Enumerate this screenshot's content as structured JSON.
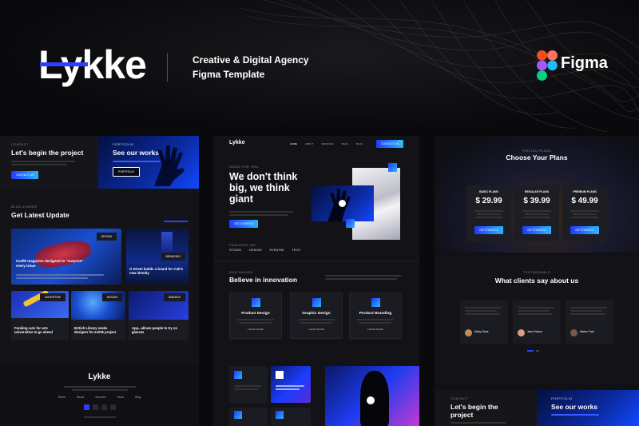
{
  "header": {
    "logo": "Lykke",
    "tagline_line1": "Creative & Digital Agency",
    "tagline_line2": "Figma Template",
    "tool": "Figma"
  },
  "colors": {
    "accent": "#1f3bff",
    "accent2": "#2ab4ff",
    "bg": "#0a0a0c",
    "panel": "#141418"
  },
  "left": {
    "contact_kicker": "CONTACT",
    "contact_title": "Let's begin the project",
    "contact_btn": "CONTACT US",
    "portfolio_kicker": "PORTFOLIO",
    "portfolio_title": "See our works",
    "portfolio_btn": "PORTFOLIO",
    "news_kicker": "BLOG & NEWS",
    "news_title": "Get Latest Update",
    "posts": [
      {
        "tag": "DESIGN",
        "title": "Grafik magazine designed to \"surprise\" every issue"
      },
      {
        "tag": "BRANDING",
        "title": "O Street builds a brand for Cult's new identity"
      },
      {
        "tag": "ADVERTISE",
        "title": "Funding cuts for arts universities to go ahead"
      },
      {
        "tag": "DESIGN",
        "title": "British Library seeks designer for £100k project"
      },
      {
        "tag": "AWARDS",
        "title": "App...allows people to try on glasses"
      }
    ],
    "footer_logo": "Lykke",
    "footer_nav": [
      "Home",
      "About",
      "Services",
      "Team",
      "Blog"
    ]
  },
  "middle": {
    "logo": "Lykke",
    "nav": [
      "HOME",
      "ABOUT",
      "SERVICES",
      "TEAM",
      "BLOG"
    ],
    "nav_btn": "CONTACT US",
    "hero_kicker": "IDEAS FOR YOU",
    "hero_title_1": "We don't think",
    "hero_title_2": "big, we think",
    "hero_title_3": "giant",
    "hero_btn": "GET STARTED",
    "featured_kicker": "FEATURED ON",
    "featured_logos": [
      "STUDIO",
      "DESIGN",
      "EVENTIM",
      "TECH"
    ],
    "values_kicker": "OUR VALUES",
    "values_title": "Believe in innovation",
    "services": [
      "Product Design",
      "Graphic Design",
      "Product Branding"
    ],
    "learn_more": "LEARN MORE"
  },
  "right": {
    "pricing_kicker": "PRICING PLANS",
    "pricing_title": "Choose Your Plans",
    "plans": [
      {
        "name": "BASIC PLANS",
        "price": "$ 29.99",
        "btn": "GET STARTED"
      },
      {
        "name": "REGULAR PLANS",
        "price": "$ 39.99",
        "btn": "GET STARTED"
      },
      {
        "name": "PREMIUM PLANS",
        "price": "$ 49.99",
        "btn": "GET STARTED"
      }
    ],
    "testimonial_kicker": "TESTIMONIALS",
    "testimonial_title": "What clients say about us",
    "clients": [
      "Mindy Stout",
      "Jane Folsom",
      "Marlon Tosh"
    ],
    "contact_kicker": "CONTACT",
    "contact_title": "Let's begin the project",
    "portfolio_kicker": "PORTFOLIO",
    "portfolio_title": "See our works"
  }
}
